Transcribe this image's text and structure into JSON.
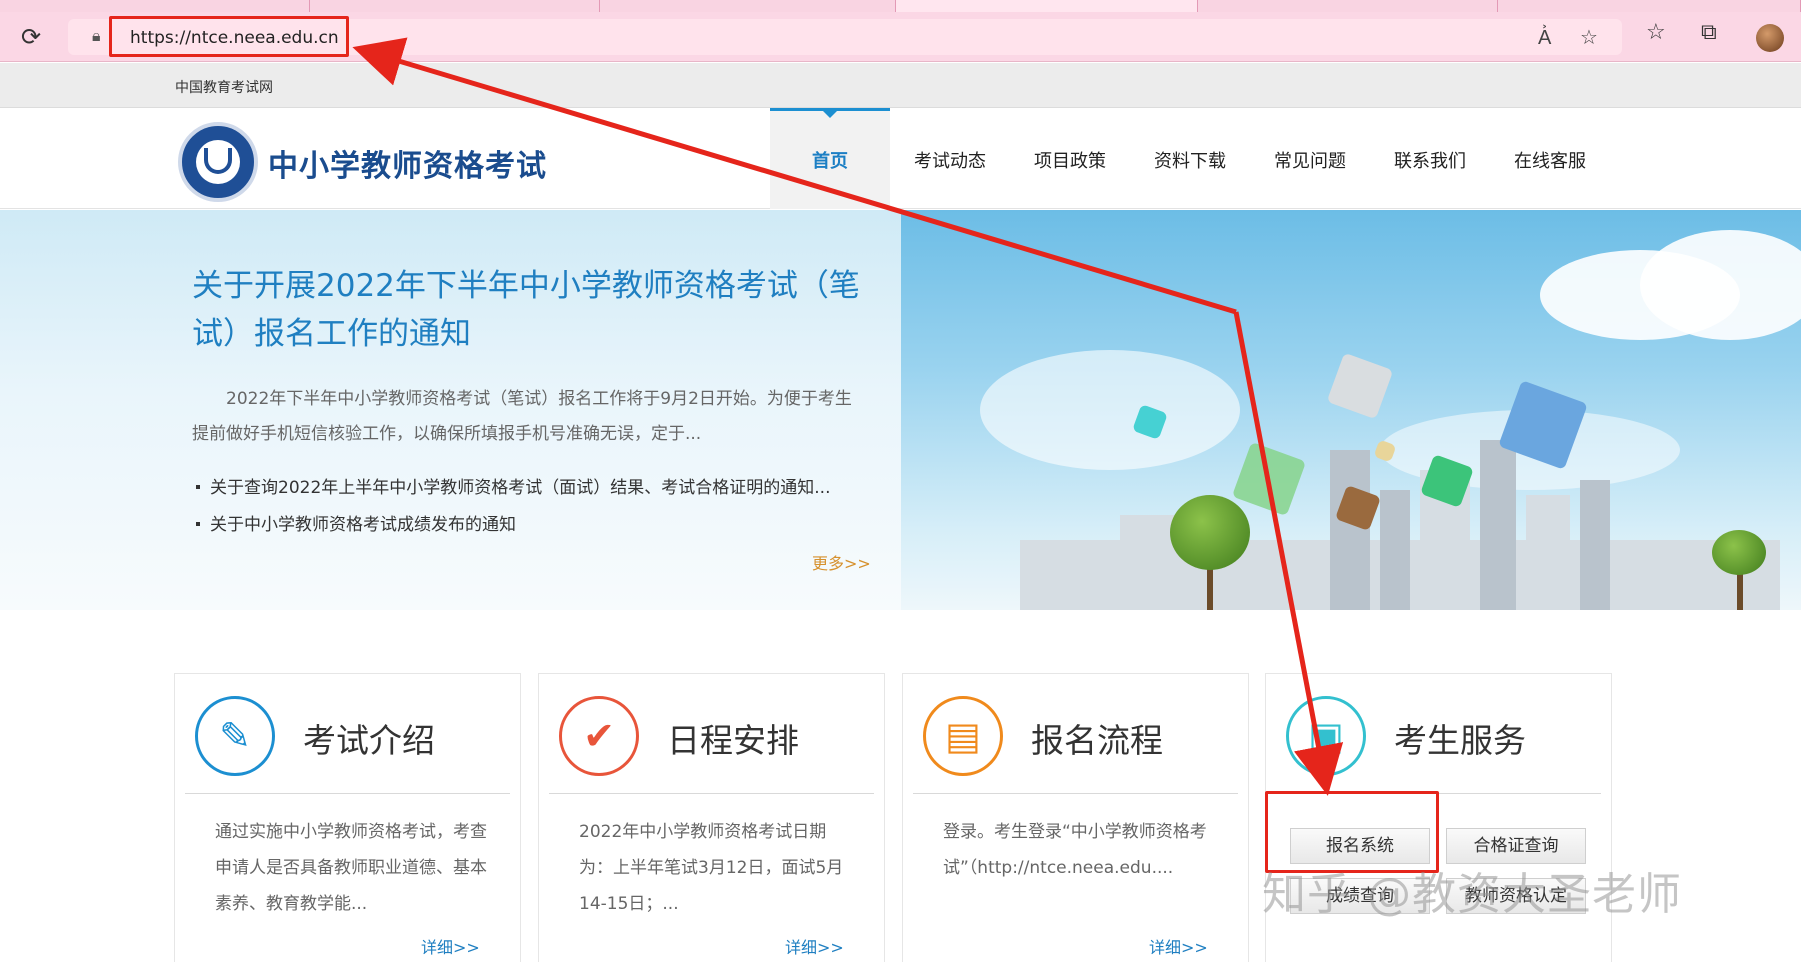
{
  "browser": {
    "url": "https://ntce.neea.edu.cn"
  },
  "topbar": {
    "link": "中国教育考试网"
  },
  "header": {
    "site_title": "中小学教师资格考试",
    "nav": [
      "首页",
      "考试动态",
      "项目政策",
      "资料下载",
      "常见问题",
      "联系我们",
      "在线客服"
    ]
  },
  "banner": {
    "headline": "关于开展2022年下半年中小学教师资格考试（笔试）报名工作的通知",
    "summary": "2022年下半年中小学教师资格考试（笔试）报名工作将于9月2日开始。为便于考生提前做好手机短信核验工作，以确保所填报手机号准确无误，定于...",
    "links": [
      "关于查询2022年上半年中小学教师资格考试（面试）结果、考试合格证明的通知...",
      "关于中小学教师资格考试成绩发布的通知"
    ],
    "more": "更多>>"
  },
  "cards": [
    {
      "title": "考试介绍",
      "icon": "document-pen-icon",
      "color": "#1c8fd1",
      "body": "通过实施中小学教师资格考试，考查申请人是否具备教师职业道德、基本素养、教育教学能...",
      "more": "详细>>"
    },
    {
      "title": "日程安排",
      "icon": "checkmark-icon",
      "color": "#e8553a",
      "body": "2022年中小学教师资格考试日期为：上半年笔试3月12日，面试5月14-15日；...",
      "more": "详细>>"
    },
    {
      "title": "报名流程",
      "icon": "form-card-icon",
      "color": "#f08a1c",
      "body": "登录。考生登录“中小学教师资格考试”（http://ntce.neea.edu....",
      "more": "详细>>"
    },
    {
      "title": "考生服务",
      "icon": "id-badge-icon",
      "color": "#33c0cf",
      "buttons": [
        "报名系统",
        "合格证查询",
        "成绩查询",
        "教师资格认定"
      ]
    }
  ],
  "watermark": "知乎 @教资大圣老师",
  "colors": {
    "annotation": "#e5251b",
    "link_blue": "#1f7fc1",
    "more_orange": "#d6912d"
  }
}
